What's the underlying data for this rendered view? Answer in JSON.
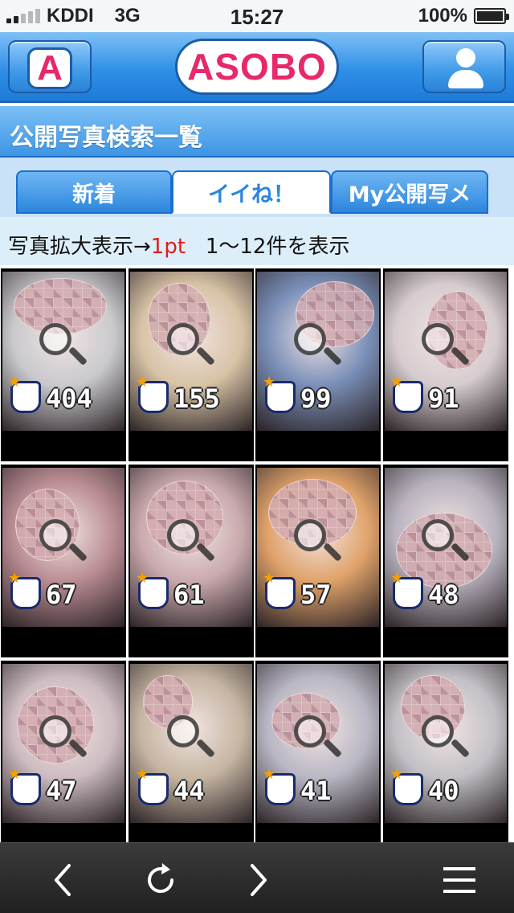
{
  "status_bar": {
    "carrier": "KDDI",
    "network": "3G",
    "time": "15:27",
    "battery": "100%",
    "signal_bars": 5,
    "signal_active": 2
  },
  "header": {
    "left_button_icon": "a-logo-icon",
    "left_button_letter": "A",
    "logo_text": "ASOBO",
    "right_button_icon": "user-icon",
    "colors": {
      "header_blue": "#2f8fe6",
      "logo_pink": "#e8286c"
    }
  },
  "page_title": "公開写真検索一覧",
  "tabs": [
    {
      "label": "新着",
      "active": false
    },
    {
      "label": "イイね！",
      "active": true
    },
    {
      "label": "My公開写メ",
      "active": false
    }
  ],
  "info": {
    "enlarge_prefix": "写真拡大表示→",
    "enlarge_cost": "1pt",
    "result_range": "1〜12件を表示"
  },
  "photos": [
    {
      "likes": "404",
      "tone": "#c9c9cd"
    },
    {
      "likes": "155",
      "tone": "#d8c3a6"
    },
    {
      "likes": "99",
      "tone": "#7a8fb8"
    },
    {
      "likes": "91",
      "tone": "#d6cccf"
    },
    {
      "likes": "67",
      "tone": "#b98c93"
    },
    {
      "likes": "61",
      "tone": "#c9a9ad"
    },
    {
      "likes": "57",
      "tone": "#e0a26a"
    },
    {
      "likes": "48",
      "tone": "#b9b3bf"
    },
    {
      "likes": "47",
      "tone": "#cdbcc1"
    },
    {
      "likes": "44",
      "tone": "#c6b5a2"
    },
    {
      "likes": "41",
      "tone": "#b9b7c4"
    },
    {
      "likes": "40",
      "tone": "#c2c0c6"
    }
  ],
  "toolbar": {
    "items": [
      "back-arrow-icon",
      "reload-icon",
      "forward-arrow-icon",
      "menu-icon"
    ]
  }
}
